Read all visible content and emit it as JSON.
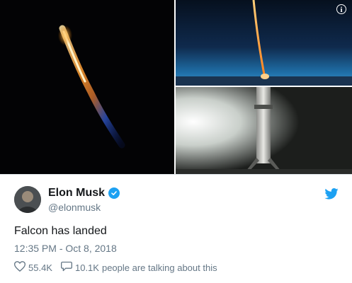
{
  "tweet": {
    "display_name": "Elon Musk",
    "handle": "@elonmusk",
    "text": "Falcon has landed",
    "timestamp": "12:35 PM - Oct 8, 2018",
    "likes": "55.4K",
    "replies": "10.1K",
    "replies_suffix": "people are talking about this"
  },
  "icons": {
    "info": "info-icon",
    "verified": "verified-badge-icon",
    "brand": "twitter-bird-icon",
    "like": "heart-icon",
    "reply": "speech-bubble-icon"
  },
  "colors": {
    "brand_blue": "#1da1f2",
    "text_primary": "#14171a",
    "text_secondary": "#657786"
  }
}
